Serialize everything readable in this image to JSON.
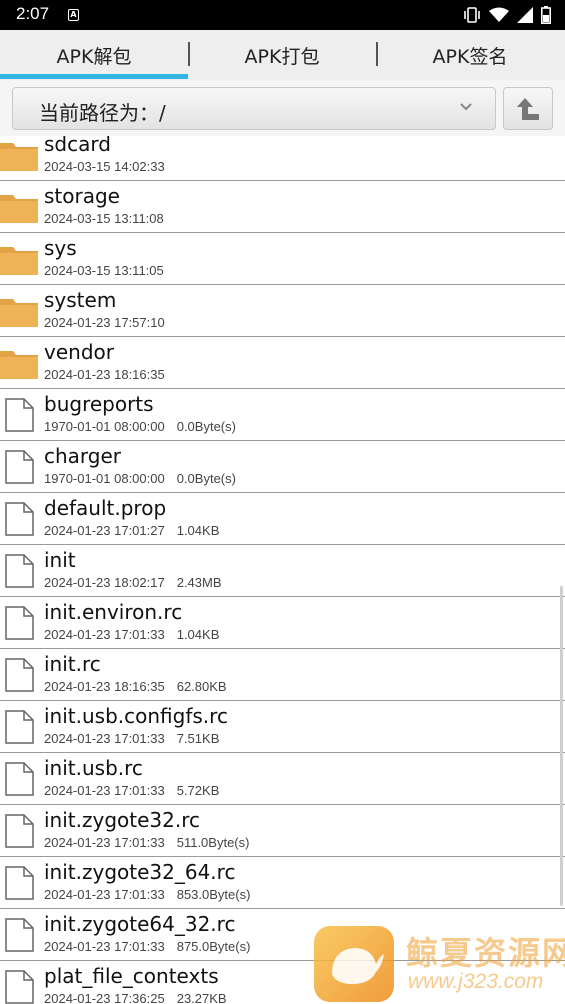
{
  "status_bar": {
    "time": "2:07",
    "notification_icon": "A",
    "icons": [
      "vibrate-icon",
      "wifi-icon",
      "signal-icon",
      "battery-icon"
    ]
  },
  "tabs": [
    {
      "label": "APK解包",
      "active": true
    },
    {
      "label": "APK打包",
      "active": false
    },
    {
      "label": "APK签名",
      "active": false
    }
  ],
  "path": {
    "label": "当前路径为：/"
  },
  "files": [
    {
      "name": "sdcard",
      "date": "2024-03-15 14:02:33",
      "size": "",
      "type": "folder"
    },
    {
      "name": "storage",
      "date": "2024-03-15 13:11:08",
      "size": "",
      "type": "folder"
    },
    {
      "name": "sys",
      "date": "2024-03-15 13:11:05",
      "size": "",
      "type": "folder"
    },
    {
      "name": "system",
      "date": "2024-01-23 17:57:10",
      "size": "",
      "type": "folder"
    },
    {
      "name": "vendor",
      "date": "2024-01-23 18:16:35",
      "size": "",
      "type": "folder"
    },
    {
      "name": "bugreports",
      "date": "1970-01-01 08:00:00",
      "size": "0.0Byte(s)",
      "type": "file"
    },
    {
      "name": "charger",
      "date": "1970-01-01 08:00:00",
      "size": "0.0Byte(s)",
      "type": "file"
    },
    {
      "name": "default.prop",
      "date": "2024-01-23 17:01:27",
      "size": "1.04KB",
      "type": "file"
    },
    {
      "name": "init",
      "date": "2024-01-23 18:02:17",
      "size": "2.43MB",
      "type": "file"
    },
    {
      "name": "init.environ.rc",
      "date": "2024-01-23 17:01:33",
      "size": "1.04KB",
      "type": "file"
    },
    {
      "name": "init.rc",
      "date": "2024-01-23 18:16:35",
      "size": "62.80KB",
      "type": "file"
    },
    {
      "name": "init.usb.configfs.rc",
      "date": "2024-01-23 17:01:33",
      "size": "7.51KB",
      "type": "file"
    },
    {
      "name": "init.usb.rc",
      "date": "2024-01-23 17:01:33",
      "size": "5.72KB",
      "type": "file"
    },
    {
      "name": "init.zygote32.rc",
      "date": "2024-01-23 17:01:33",
      "size": "511.0Byte(s)",
      "type": "file"
    },
    {
      "name": "init.zygote32_64.rc",
      "date": "2024-01-23 17:01:33",
      "size": "853.0Byte(s)",
      "type": "file"
    },
    {
      "name": "init.zygote64_32.rc",
      "date": "2024-01-23 17:01:33",
      "size": "875.0Byte(s)",
      "type": "file"
    },
    {
      "name": "plat_file_contexts",
      "date": "2024-01-23 17:36:25",
      "size": "23.27KB",
      "type": "file"
    }
  ],
  "watermark": {
    "title": "鲸夏资源网",
    "url": "www.j323.com"
  },
  "colors": {
    "tab_indicator": "#33b5e5",
    "folder": "#e8a84a",
    "divider": "#9a9a9a"
  }
}
